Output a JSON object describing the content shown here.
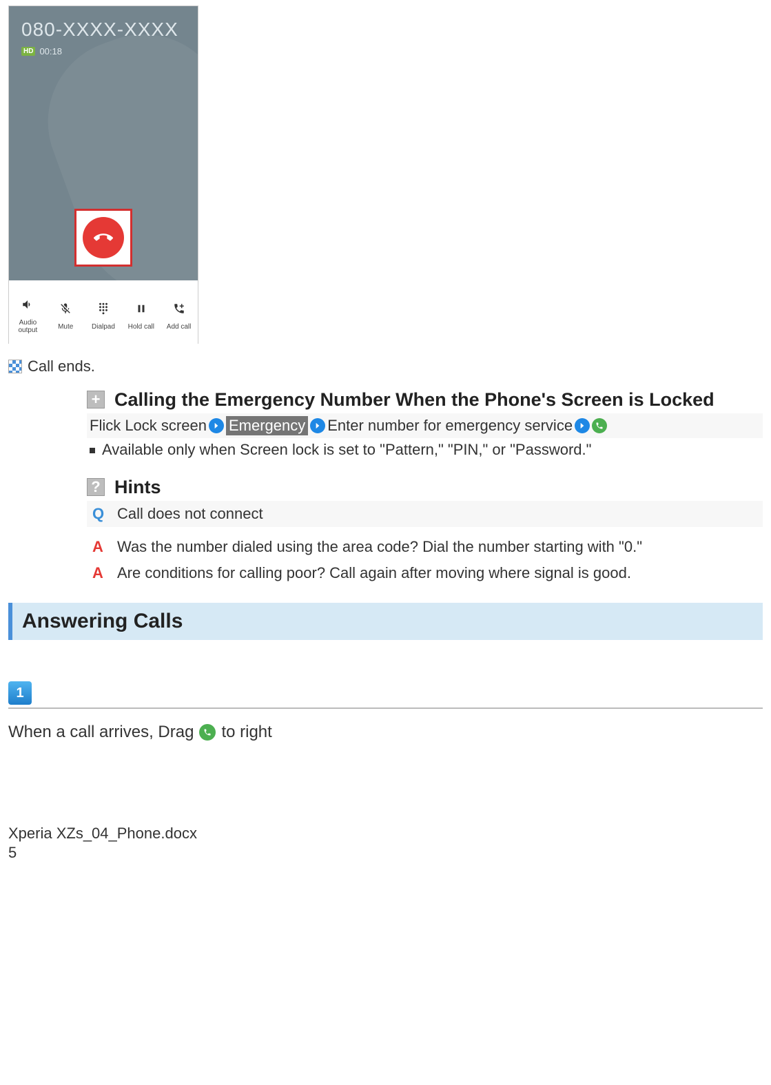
{
  "screenshot": {
    "phone_number": "080-XXXX-XXXX",
    "hd_badge": "HD",
    "call_time": "00:18",
    "actions": {
      "audio": "Audio output",
      "mute": "Mute",
      "dialpad": "Dialpad",
      "hold": "Hold call",
      "add": "Add call"
    }
  },
  "call_ends": "Call ends.",
  "emergency": {
    "heading": "Calling the Emergency Number When the Phone's Screen is Locked",
    "step1": "Flick Lock screen",
    "badge": "Emergency",
    "step2": "Enter number for emergency service",
    "note": "Available only when Screen lock is set to \"Pattern,\" \"PIN,\" or \"Password.\""
  },
  "hints": {
    "heading": "Hints",
    "q": "Call does not connect",
    "a1": "Was the number dialed using the area code? Dial the number starting with \"0.\"",
    "a2": "Are conditions for calling poor? Call again after moving where signal is good."
  },
  "answering": {
    "heading": "Answering Calls",
    "step_num": "1",
    "step_pre": "When a call arrives, Drag",
    "step_post": "to right"
  },
  "footer": {
    "filename": "Xperia XZs_04_Phone.docx",
    "page": "5"
  }
}
